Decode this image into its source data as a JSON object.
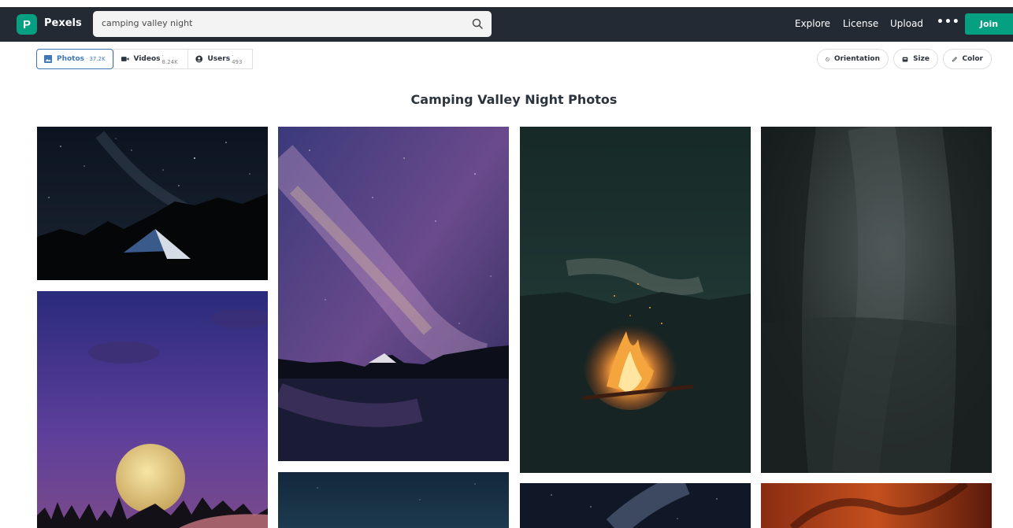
{
  "header": {
    "logo_letter": "P",
    "brand": "Pexels",
    "search_value": "camping valley night",
    "nav_links": [
      "Explore",
      "License",
      "Upload"
    ],
    "more": "•••",
    "join": "Join"
  },
  "tabs": [
    {
      "label": "Photos",
      "count": "· 37.2K",
      "icon": "image-icon",
      "active": true
    },
    {
      "label": "Videos",
      "count": "· 8.24K",
      "icon": "video-icon",
      "active": false
    },
    {
      "label": "Users",
      "count": "· 493",
      "icon": "user-icon",
      "active": false
    }
  ],
  "filters": [
    {
      "label": "Orientation",
      "icon": "orientation-icon"
    },
    {
      "label": "Size",
      "icon": "size-icon"
    },
    {
      "label": "Color",
      "icon": "pen-icon"
    }
  ],
  "page_title": "Camping Valley Night Photos",
  "colors": {
    "nav_bg": "#232a34",
    "accent": "#05a081",
    "active_tab": "#3f78b4"
  },
  "photos": [
    {
      "subject": "night-tent-silhouette-photo"
    },
    {
      "subject": "full-moon-purple-sky-photo"
    },
    {
      "subject": "milky-way-lake-reflection-photo"
    },
    {
      "subject": "night-sky-lake-photo"
    },
    {
      "subject": "campfire-night-photo"
    },
    {
      "subject": "milky-way-mountain-photo"
    },
    {
      "subject": "foggy-dark-forest-photo"
    },
    {
      "subject": "red-rock-cave-photo"
    }
  ]
}
